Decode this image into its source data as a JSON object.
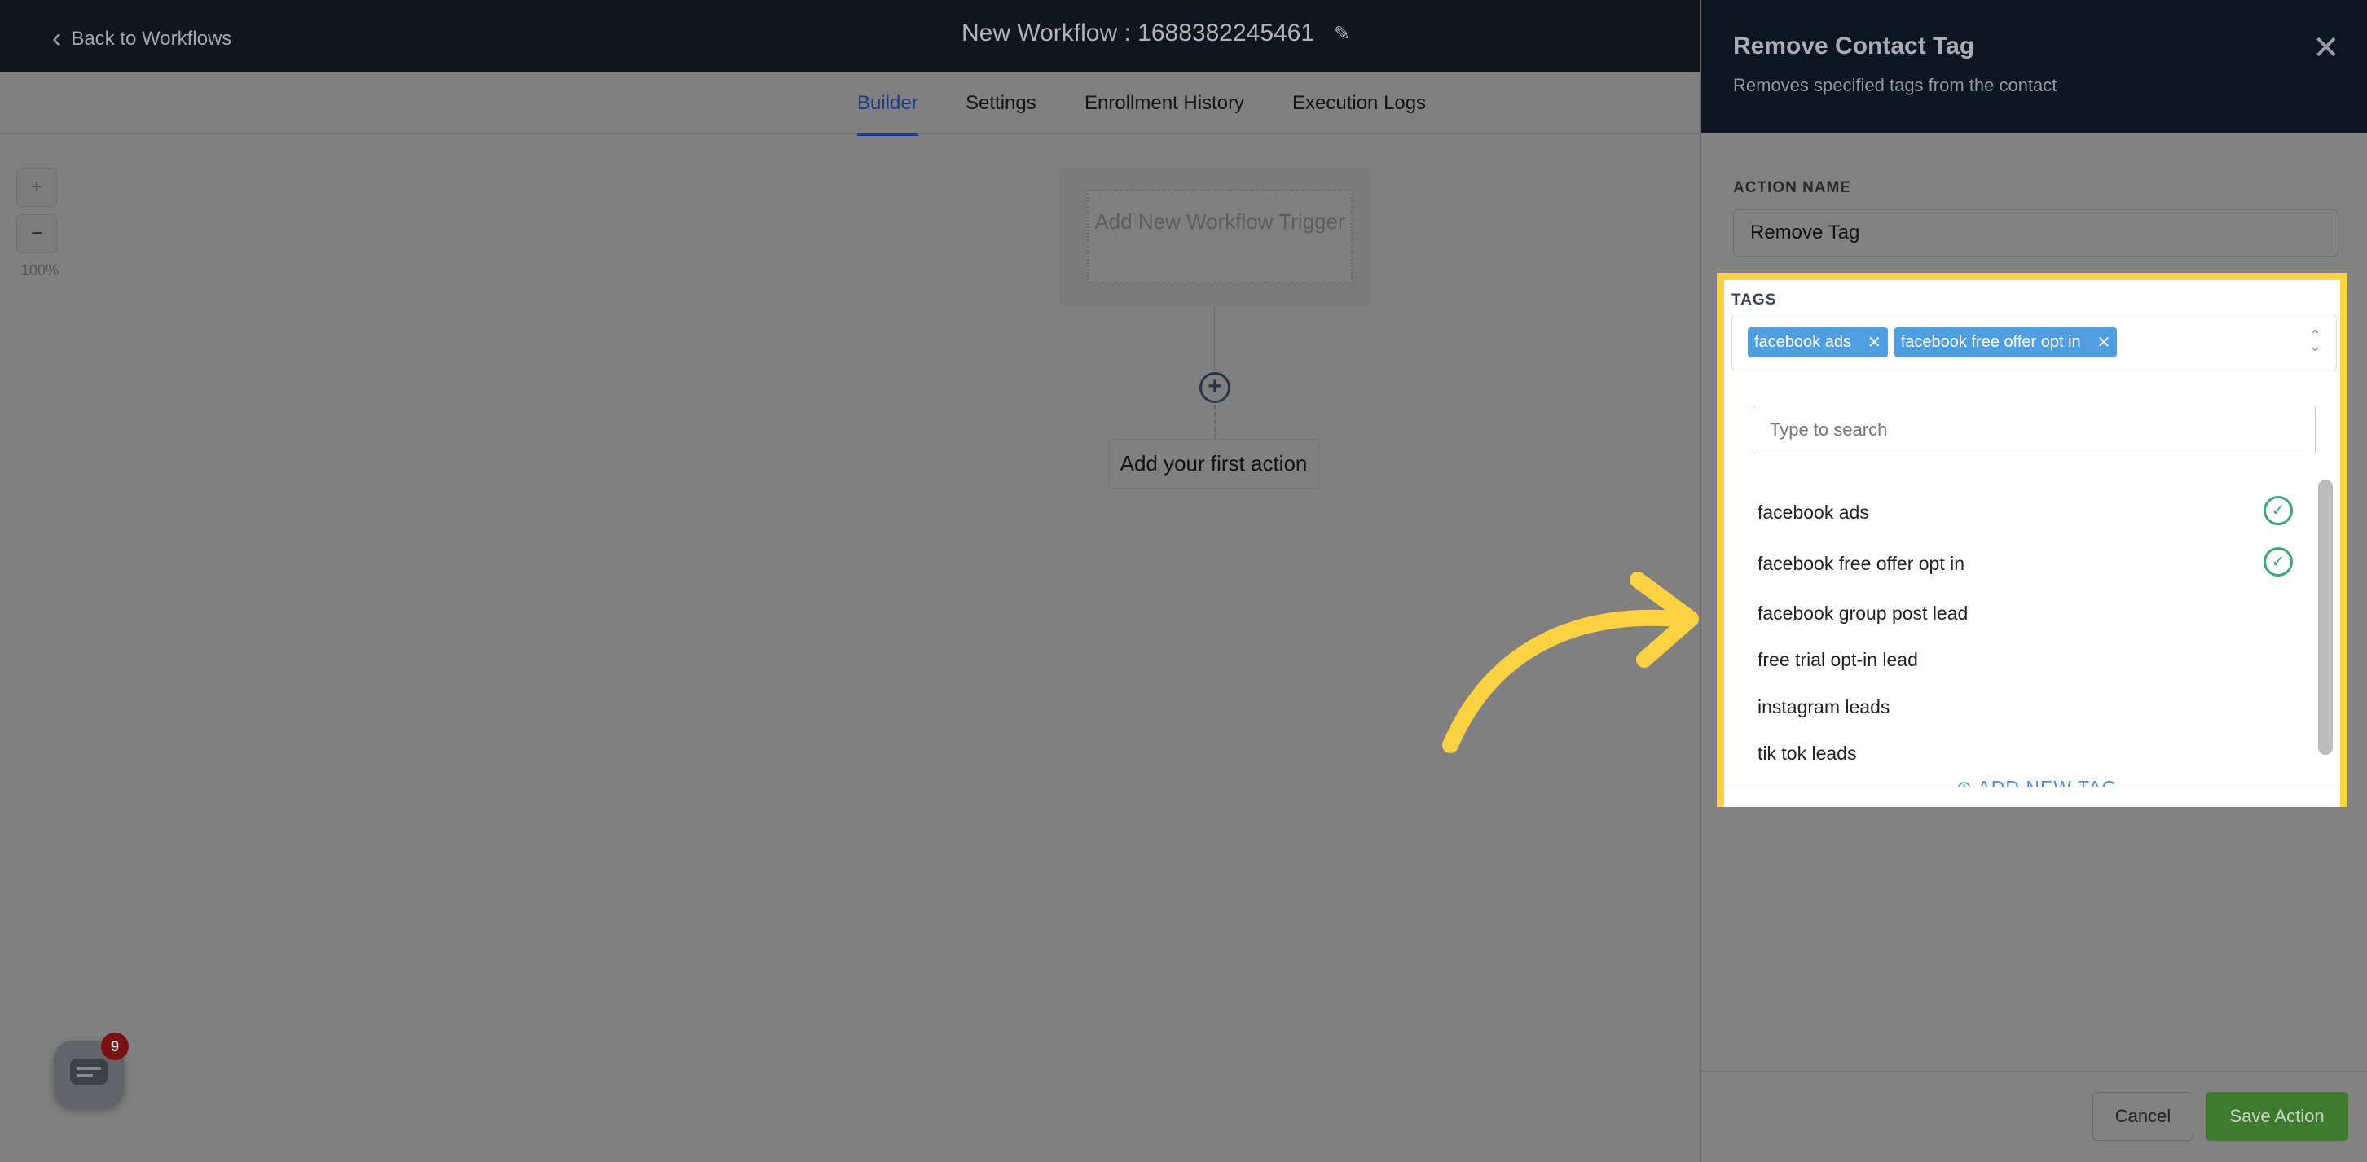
{
  "header": {
    "back_label": "Back to Workflows",
    "title": "New Workflow : 1688382245461"
  },
  "tabs": [
    {
      "label": "Builder",
      "active": true
    },
    {
      "label": "Settings"
    },
    {
      "label": "Enrollment History"
    },
    {
      "label": "Execution Logs"
    }
  ],
  "canvas": {
    "zoom_in": "+",
    "zoom_out": "−",
    "zoom_level": "100%",
    "trigger_label": "Add New Workflow Trigger",
    "first_action_label": "Add your first action",
    "chat_badge": "9"
  },
  "panel": {
    "title": "Remove Contact Tag",
    "subtitle": "Removes specified tags from the contact",
    "action_name_label": "ACTION NAME",
    "action_name_value": "Remove Tag",
    "tags_label": "TAGS",
    "selected_tags": [
      "facebook ads",
      "facebook free offer opt in"
    ],
    "search_placeholder": "Type to search",
    "options": [
      {
        "label": "facebook ads",
        "selected": true
      },
      {
        "label": "facebook free offer opt in",
        "selected": true
      },
      {
        "label": "facebook group post lead"
      },
      {
        "label": "free trial opt-in lead"
      },
      {
        "label": "instagram leads"
      },
      {
        "label": "tik tok leads"
      }
    ],
    "add_new_tag": "ADD NEW TAG",
    "cancel": "Cancel",
    "save": "Save Action"
  },
  "colors": {
    "highlight": "#fdd142",
    "chip": "#4d9ee3",
    "check": "#3ba776",
    "save": "#3c7a2e",
    "header": "#10151e"
  }
}
